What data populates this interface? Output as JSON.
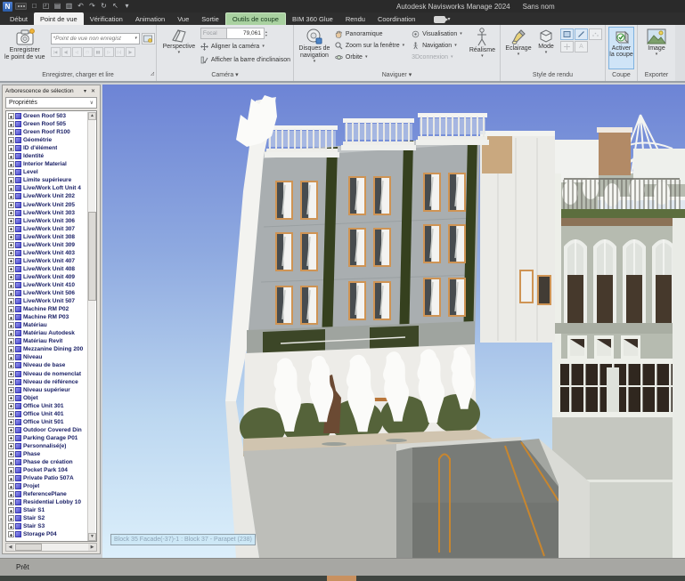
{
  "window": {
    "title": "Autodesk Navisworks Manage 2024",
    "document": "Sans nom"
  },
  "quick_access": [
    {
      "name": "new-file-icon",
      "glyph": "□"
    },
    {
      "name": "open-file-icon",
      "glyph": "◰"
    },
    {
      "name": "save-icon",
      "glyph": "▤"
    },
    {
      "name": "print-icon",
      "glyph": "▥"
    },
    {
      "name": "undo-icon",
      "glyph": "↶"
    },
    {
      "name": "redo-icon",
      "glyph": "↷"
    },
    {
      "name": "refresh-icon",
      "glyph": "↻"
    },
    {
      "name": "select-cursor-icon",
      "glyph": "↖"
    },
    {
      "name": "qat-more-icon",
      "glyph": "▾"
    }
  ],
  "tabs": [
    {
      "label": "Début"
    },
    {
      "label": "Point de vue",
      "state": "active"
    },
    {
      "label": "Vérification"
    },
    {
      "label": "Animation"
    },
    {
      "label": "Vue"
    },
    {
      "label": "Sortie"
    },
    {
      "label": "Outils de coupe",
      "state": "context"
    },
    {
      "label": "BIM 360 Glue"
    },
    {
      "label": "Rendu"
    },
    {
      "label": "Coordination"
    }
  ],
  "ribbon": {
    "group_labels": [
      "Enregistrer, charger et lire",
      "Caméra ▾",
      "Naviguer ▾",
      "Style de rendu",
      "Coupe",
      "Exporter"
    ],
    "buttons": {
      "save_viewpoint_1": "Enregistrer",
      "save_viewpoint_2": "le point de vue",
      "viewpoint_combo": "*Point de vue non enregist",
      "perspective": "Perspective",
      "focal_label": "Focal",
      "focal_value": "79,061",
      "align_camera": "Aligner la caméra",
      "tilt_bar": "Afficher la barre d'inclinaison",
      "nav_wheel_1": "Disques de",
      "nav_wheel_2": "navigation",
      "pan": "Panoramique",
      "zoom_window": "Zoom sur la fenêtre",
      "orbit": "Orbite",
      "visualisation": "Visualisation",
      "navigation": "Navigation",
      "connexion": "3Dconnexion",
      "realism": "Réalisme",
      "lighting": "Eclairage",
      "mode": "Mode",
      "section_enable_1": "Activer",
      "section_enable_2": "la coupe",
      "image": "Image",
      "mode_letter": "A"
    },
    "media_buttons": [
      "|◀",
      "◀|",
      "◁",
      "□",
      "▮▮",
      "▷",
      "▷|",
      "|▶"
    ]
  },
  "selection_tree": {
    "title": "Arborescence de sélection",
    "combo_value": "Propriétés",
    "items": [
      "Green Roof 503",
      "Green Roof 505",
      "Green Roof R100",
      "Géométrie",
      "ID d'élément",
      "Identité",
      "Interior Material",
      "Level",
      "Limite supérieure",
      "Live/Work Loft Unit 4",
      "Live/Work Unit 202",
      "Live/Work Unit 205",
      "Live/Work Unit 303",
      "Live/Work Unit 306",
      "Live/Work Unit 307",
      "Live/Work Unit 308",
      "Live/Work Unit 309",
      "Live/Work Unit 403",
      "Live/Work Unit 407",
      "Live/Work Unit 408",
      "Live/Work Unit 409",
      "Live/Work Unit 410",
      "Live/Work Unit 506",
      "Live/Work Unit 507",
      "Machine RM P02",
      "Machine RM P03",
      "Matériau",
      "Matériau Autodesk",
      "Matériau Revit",
      "Mezzanine Dining 200",
      "Niveau",
      "Niveau de base",
      "Niveau de nomenclat",
      "Niveau de référence",
      "Niveau supérieur",
      "Objet",
      "Office Unit 301",
      "Office Unit 401",
      "Office Unit 501",
      "Outdoor Covered Din",
      "Parking Garage P01",
      "Personnalisé(e)",
      "Phase",
      "Phase de création",
      "Pocket Park 104",
      "Private Patio 507A",
      "Projet",
      "ReferencePlane",
      "Residential Lobby 10",
      "Stair S1",
      "Stair S2",
      "Stair S3",
      "Storage P04"
    ]
  },
  "viewport": {
    "tooltip": "Block 35 Facade(-37)-1 : Block 37 - Parapet (238)"
  },
  "statusbar": {
    "text": "Prêt"
  }
}
